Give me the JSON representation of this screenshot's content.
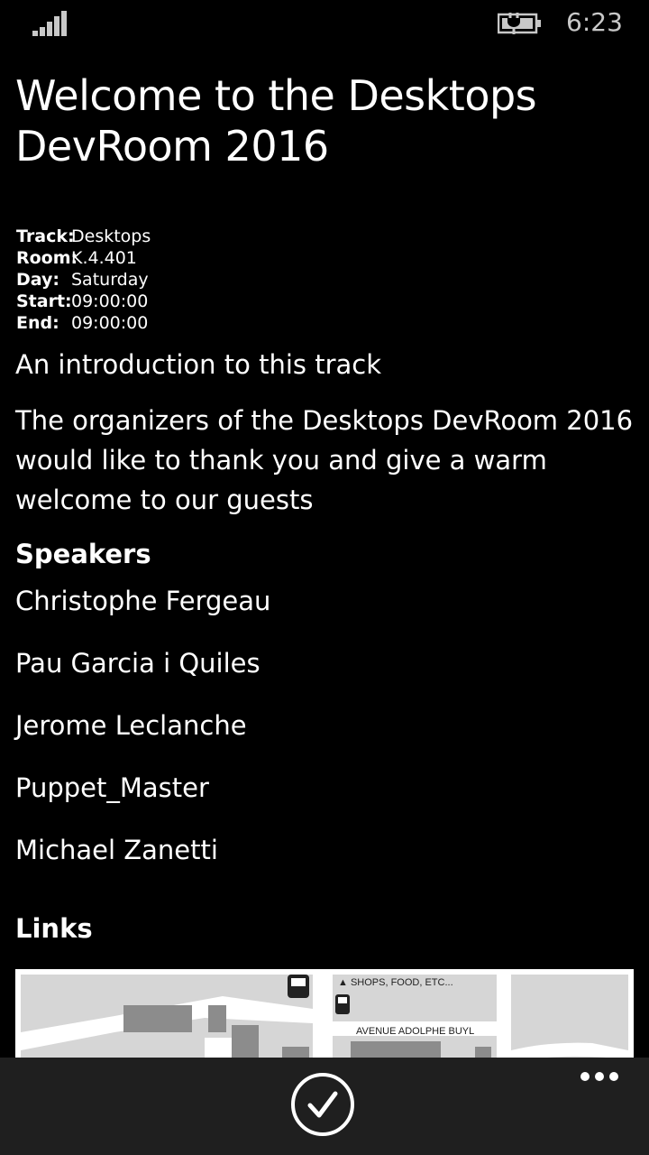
{
  "status_bar": {
    "time": "6:23",
    "signal_icon": "signal-icon",
    "battery_icon": "battery-charging-icon"
  },
  "page": {
    "title": "Welcome to the Desktops DevRoom 2016"
  },
  "meta": {
    "rows": [
      {
        "key": "Track:",
        "value": "Desktops"
      },
      {
        "key": "Room:",
        "value": "K.4.401"
      },
      {
        "key": "Day:",
        "value": "Saturday"
      },
      {
        "key": "Start:",
        "value": "09:00:00"
      },
      {
        "key": "End:",
        "value": "09:00:00"
      }
    ]
  },
  "subtitle": "An introduction to this track",
  "description": "The organizers of the Desktops DevRoom 2016 would like to thank you and give a warm welcome to our guests",
  "speakers": {
    "heading": "Speakers",
    "items": [
      "Christophe Fergeau",
      "Pau Garcia i Quiles",
      "Jerome Leclanche",
      "Puppet_Master",
      "Michael Zanetti"
    ]
  },
  "links": {
    "heading": "Links",
    "map_labels": {
      "shops": "▲ SHOPS, FOOD, ETC...",
      "street": "AVENUE ADOLPHE BUYL"
    }
  },
  "app_bar": {
    "primary_icon": "check-icon",
    "more_icon": "more-icon"
  }
}
